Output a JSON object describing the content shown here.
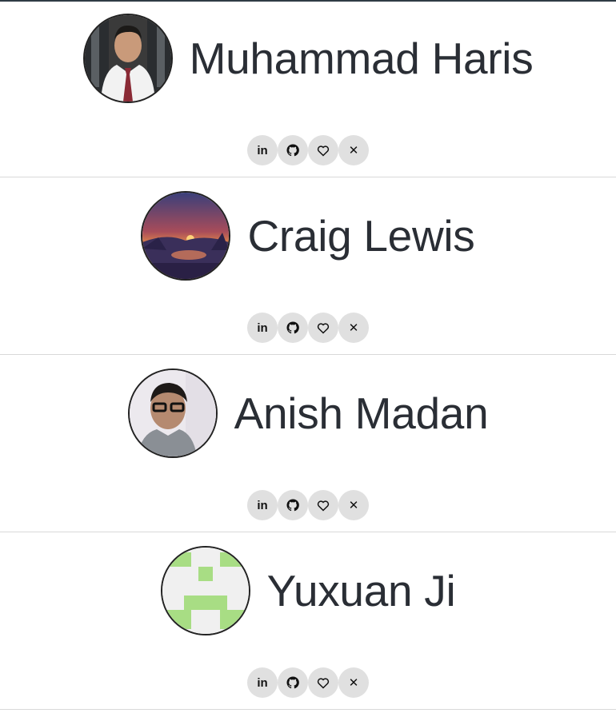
{
  "people": [
    {
      "name": "Muhammad Haris",
      "avatar": "photo-portrait-suit",
      "socials": [
        {
          "icon": "linkedin-icon",
          "label": "in"
        },
        {
          "icon": "github-icon",
          "label": ""
        },
        {
          "icon": "heart-icon",
          "label": ""
        },
        {
          "icon": "x-twitter-icon",
          "label": "✕"
        }
      ]
    },
    {
      "name": "Craig Lewis",
      "avatar": "sunset-landscape",
      "socials": [
        {
          "icon": "linkedin-icon",
          "label": "in"
        },
        {
          "icon": "github-icon",
          "label": ""
        },
        {
          "icon": "heart-icon",
          "label": ""
        },
        {
          "icon": "x-twitter-icon",
          "label": "✕"
        }
      ]
    },
    {
      "name": "Anish Madan",
      "avatar": "photo-portrait-glasses",
      "socials": [
        {
          "icon": "linkedin-icon",
          "label": "in"
        },
        {
          "icon": "github-icon",
          "label": ""
        },
        {
          "icon": "heart-icon",
          "label": ""
        },
        {
          "icon": "x-twitter-icon",
          "label": "✕"
        }
      ]
    },
    {
      "name": "Yuxuan Ji",
      "avatar": "identicon-green",
      "socials": [
        {
          "icon": "linkedin-icon",
          "label": "in"
        },
        {
          "icon": "github-icon",
          "label": ""
        },
        {
          "icon": "heart-icon",
          "label": ""
        },
        {
          "icon": "x-twitter-icon",
          "label": "✕"
        }
      ]
    }
  ],
  "colors": {
    "text": "#2a2e35",
    "divider": "#d9d9d9",
    "social_bg": "#e0e0e0",
    "identicon_green": "#a8dd84",
    "identicon_bg": "#f0f0f0"
  }
}
